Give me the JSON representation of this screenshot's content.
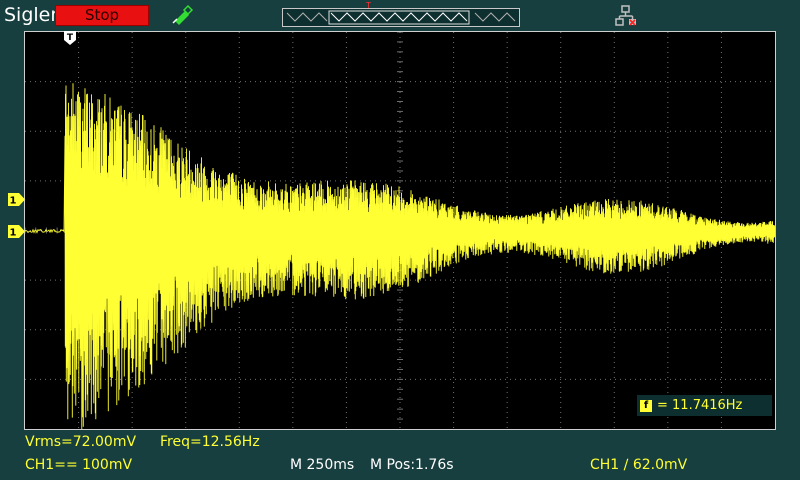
{
  "header": {
    "brand": "Siglent",
    "run_status": "Stop",
    "trigger_state_icon": "trigger-armed-icon",
    "timebase_window_icon": "timebase-window-icon",
    "network_icon": "network-icon"
  },
  "measurements": {
    "vrms": "Vrms=72.00mV",
    "freq": "Freq=12.56Hz"
  },
  "frequency_counter": {
    "icon": "f",
    "value": "= 11.7416Hz"
  },
  "channel_markers": {
    "trigger_level": "T",
    "ch1_ground": "1"
  },
  "status_bar": {
    "ch1_scale": "CH1== 100mV",
    "timebase": "M 250ms",
    "position": "M Pos:1.76s",
    "trigger": "CH1 ∕ 62.0mV"
  },
  "colors": {
    "trace": "#ffff33",
    "background": "#173f3f",
    "screen": "#000000",
    "run_status": "#e81010"
  }
}
